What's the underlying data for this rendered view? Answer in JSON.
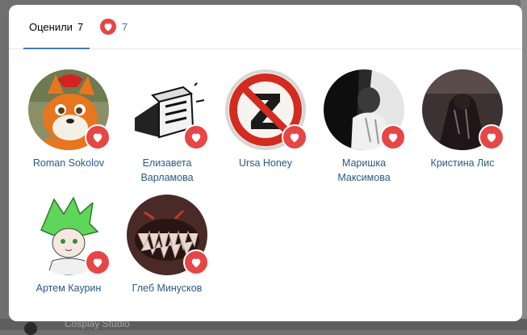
{
  "tabs": {
    "likes": {
      "label": "Оценили",
      "count": "7"
    },
    "reactions": {
      "icon": "heart-icon",
      "count": "7"
    }
  },
  "users": [
    {
      "name": "Roman Sokolov",
      "avatar": "fox-fursuit-avatar"
    },
    {
      "name": "Елизавета Варламова",
      "avatar": "sketch-drawing-avatar"
    },
    {
      "name": "Ursa Honey",
      "avatar": "prohibited-z-sign-avatar"
    },
    {
      "name": "Маришка Максимова",
      "avatar": "bw-photo-avatar"
    },
    {
      "name": "Кристина Лис",
      "avatar": "dark-photo-avatar"
    },
    {
      "name": "Артем Каурин",
      "avatar": "anime-drawing-avatar"
    },
    {
      "name": "Глеб Минусков",
      "avatar": "teeth-monster-avatar"
    }
  ],
  "background": {
    "bottom_text": "Cosplay Studio"
  },
  "colors": {
    "accent": "#447bba",
    "like": "#e64646",
    "link": "#2a5885"
  }
}
